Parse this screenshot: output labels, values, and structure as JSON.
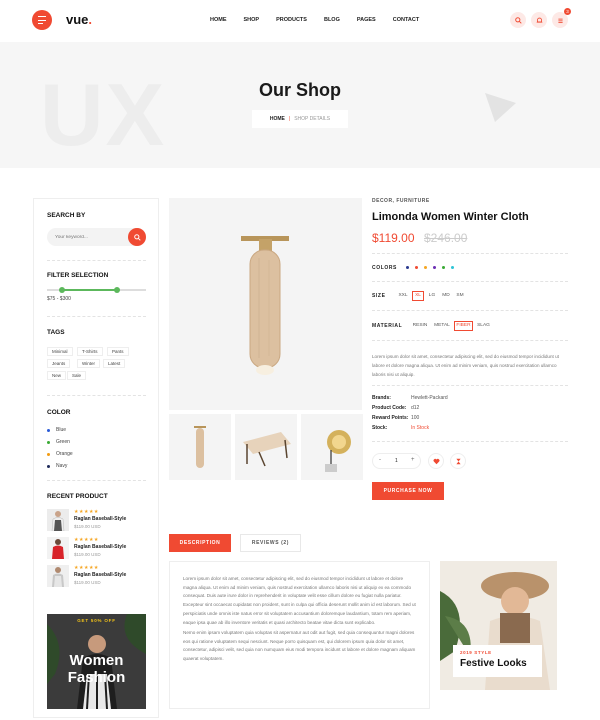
{
  "header": {
    "logo_text": "vue",
    "logo_dot": ".",
    "nav": [
      "HOME",
      "SHOP",
      "PRODUCTS",
      "BLOG",
      "PAGES",
      "CONTACT"
    ],
    "cart_count": "3"
  },
  "hero": {
    "watermark": "UX",
    "title": "Our Shop",
    "breadcrumb_home": "HOME",
    "breadcrumb_sep": "|",
    "breadcrumb_current": "SHOP DETAILS"
  },
  "sidebar": {
    "search_title": "SEARCH BY",
    "search_placeholder": "Your keyword...",
    "filter_title": "FILTER SELECTION",
    "price_range": "$75 - $300",
    "price_range_fraction": [
      0.15,
      0.71
    ],
    "tags_title": "TAGS",
    "tags": [
      "Minimal",
      "T-Shirts",
      "Pants",
      "Jeants",
      "Winter",
      "Latest",
      "New",
      "Sale"
    ],
    "color_title": "COLOR",
    "colors": [
      {
        "label": "Blue",
        "hex": "#2a5bd7"
      },
      {
        "label": "Green",
        "hex": "#3aaa35"
      },
      {
        "label": "Orange",
        "hex": "#f39c12"
      },
      {
        "label": "Navy",
        "hex": "#1f2a5a"
      }
    ],
    "recent_title": "RECENT PRODUCT",
    "recent_products": [
      {
        "stars": "★★★★★",
        "name": "Raglan Baseball-Style",
        "price": "$119.00 USD"
      },
      {
        "stars": "★★★★★",
        "name": "Raglan Baseball-Style",
        "price": "$119.00 USD"
      },
      {
        "stars": "★★★★★",
        "name": "Raglan Baseball-Style",
        "price": "$119.00 USD"
      }
    ],
    "banner_sub": "GET 50% OFF",
    "banner_line1": "Women",
    "banner_line2": "Fashion"
  },
  "product": {
    "category": "DECOR, FURNITURE",
    "title": "Limonda Women Winter Cloth",
    "price": "$119.00",
    "old_price": "$246.00",
    "colors_label": "COLORS",
    "swatches": [
      "#2a3a8f",
      "#f04a32",
      "#f5a623",
      "#6b2fb3",
      "#3aaa35",
      "#2ec4d6"
    ],
    "size_label": "SIZE",
    "sizes": [
      "XXL",
      "XL",
      "LG",
      "MD",
      "SM"
    ],
    "selected_size": "XL",
    "material_label": "MATERIAL",
    "materials": [
      "RESIN",
      "METAL",
      "FIBER",
      "SLAG"
    ],
    "selected_material": "FIBER",
    "description": "Lorem ipsum dolor sit amet, consectetur adipiscing elit, sed do eiusmod tempor incididunt ut labore et dolore magna aliqua. Ut enim ad minim veniam, quis nostrud exercitation ullamco laboris nisi ut aliquip.",
    "meta": [
      {
        "key": "Brands:",
        "value": "Hewlett-Packard"
      },
      {
        "key": "Product Code:",
        "value": "d12"
      },
      {
        "key": "Reward Points:",
        "value": "100"
      },
      {
        "key": "Stock:",
        "value": "In Stock"
      }
    ],
    "qty_minus": "-",
    "quantity": "1",
    "qty_plus": "+",
    "buy_label": "PURCHASE NOW"
  },
  "tabs": {
    "description": "DESCRIPTION",
    "reviews": "REVIEWS (2)"
  },
  "description_tab": {
    "para1": "Lorem ipsum dolor sit amet, consectetur adipiscing elit, sed do eiusmod tempor incididunt ut labore et dolore magna aliqua. Ut enim ad minim veniam, quis nostrud exercitation ullamco laboris nisi ut aliquip ex ea commodo consequat. Duis aute irure dolor in reprehenderit in voluptate velit esse cillum dolore eu fugiat nulla pariatur. Excepteur sint occaecat cupidatat non proident, sunt in culpa qui officia deserunt mollit anim id est laborum. Sed ut perspiciatis unde omnis iste natus error sit voluptatem accusantium doloremque laudantium, totam rem aperiam, eaque ipsa quae ab illo inventore veritatis et quasi architecto beatae vitae dicta sunt explicabo.",
    "para2": "Nemo enim ipsam voluptatem quia voluptas sit aspernatur aut odit aut fugit, sed quia consequuntur magni dolores eos qui ratione voluptatem sequi nesciunt. Neque porro quisquam est, qui dolorem ipsum quia dolor sit amet, consectetur, adipisci velit, sed quia non numquam eius modi tempora incidunt ut labore et dolore magnam aliquam quaerat voluptatem."
  },
  "promo": {
    "year_label": "2019 STYLE",
    "title": "Festive Looks"
  }
}
